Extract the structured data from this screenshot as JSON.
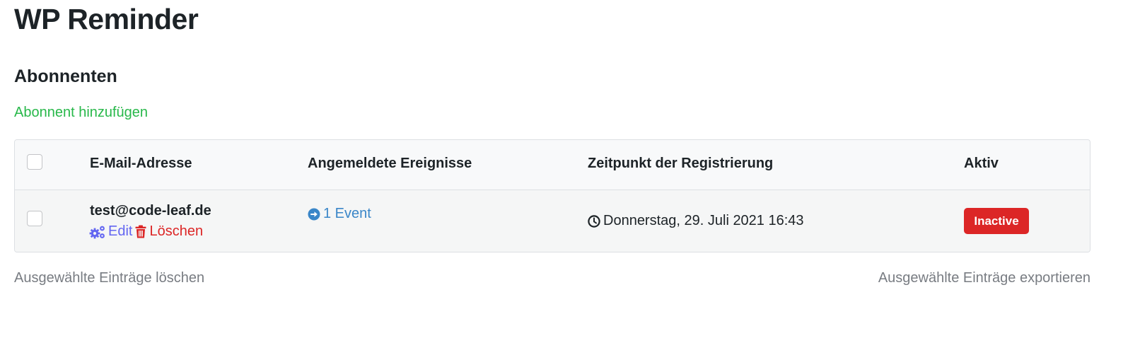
{
  "page": {
    "title": "WP Reminder",
    "section_title": "Abonnenten",
    "add_link": "Abonnent hinzufügen"
  },
  "table": {
    "headers": {
      "email": "E-Mail-Adresse",
      "events": "Angemeldete Ereignisse",
      "registered": "Zeitpunkt der Registrierung",
      "active": "Aktiv"
    },
    "rows": [
      {
        "email": "test@code-leaf.de",
        "edit_label": "Edit",
        "delete_label": "Löschen",
        "events": "1 Event",
        "registered": "Donnerstag, 29. Juli 2021 16:43",
        "status": "Inactive"
      }
    ]
  },
  "footer": {
    "delete_selected": "Ausgewählte Einträge löschen",
    "export_selected": "Ausgewählte Einträge exportieren"
  },
  "colors": {
    "add_link": "#28b84a",
    "edit_link": "#6366f1",
    "delete_link": "#dc2626",
    "event_link": "#3a86c8",
    "status_inactive": "#dc2626"
  },
  "icons": {
    "edit": "cogs-icon",
    "delete": "trash-icon",
    "events": "arrow-circle-right-icon",
    "registered": "clock-icon"
  }
}
